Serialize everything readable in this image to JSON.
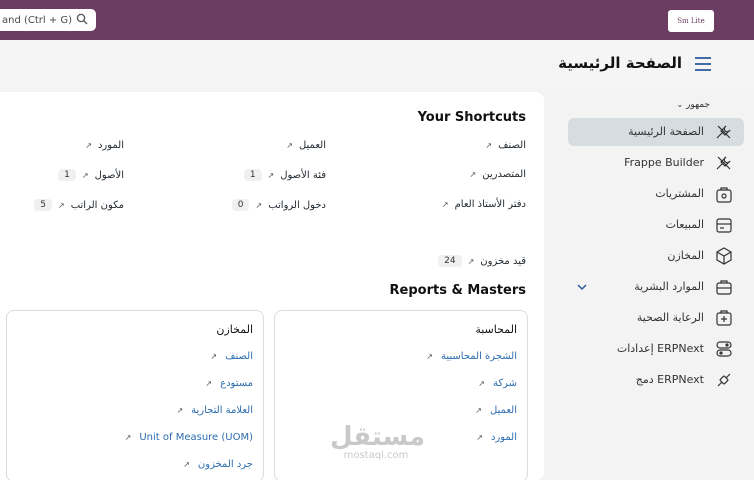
{
  "topbar": {
    "search_text": "and (Ctrl + G)",
    "logo_text": "Sm Lite"
  },
  "page": {
    "title": "الصفحة الرئيسية"
  },
  "sidebar": {
    "group_label": "جمهور",
    "items": [
      {
        "label": "الصفحة الرئيسية",
        "icon": "tools-icon",
        "active": true
      },
      {
        "label": "Frappe Builder",
        "icon": "tools-icon",
        "active": false
      },
      {
        "label": "المشتريات",
        "icon": "basket-icon",
        "active": false
      },
      {
        "label": "المبيعات",
        "icon": "wallet-icon",
        "active": false
      },
      {
        "label": "المخازن",
        "icon": "cube-icon",
        "active": false
      },
      {
        "label": "الموارد البشرية",
        "icon": "briefcase-icon",
        "active": false,
        "expandable": true
      },
      {
        "label": "الرعاية الصحية",
        "icon": "medical-kit-icon",
        "active": false
      },
      {
        "label": "إعدادات ERPNext",
        "icon": "toggle-icon",
        "active": false
      },
      {
        "label": "دمج ERPNext",
        "icon": "plug-icon",
        "active": false
      }
    ]
  },
  "shortcuts": {
    "title": "Your Shortcuts",
    "items": [
      {
        "label": "الصنف",
        "count": ""
      },
      {
        "label": "العميل",
        "count": ""
      },
      {
        "label": "المورد",
        "count": ""
      },
      {
        "label": "المتصدرين",
        "count": ""
      },
      {
        "label": "فئة الأصول",
        "count": "1"
      },
      {
        "label": "الأصول",
        "count": "1"
      },
      {
        "label": "دفتر الأستاذ العام",
        "count": ""
      },
      {
        "label": "دخول الرواتب",
        "count": "0"
      },
      {
        "label": "مكون الراتب",
        "count": "5"
      },
      {
        "label": "قيد مخزون",
        "count": "24"
      }
    ]
  },
  "reports": {
    "title": "Reports & Masters",
    "cards": [
      {
        "title": "المحاسبة",
        "links": [
          "الشجرة المحاسبية",
          "شركة",
          "العميل",
          "المورد"
        ]
      },
      {
        "title": "المخازن",
        "links": [
          "الصنف",
          "مستودع",
          "العلامة التجارية",
          "Unit of Measure (UOM)",
          "جرد المخزون"
        ]
      }
    ]
  },
  "watermark": {
    "arabic": "مستقل",
    "latin": "mostaql.com"
  },
  "colors": {
    "topbar": "#6b3d62",
    "active_item": "#d5dde1",
    "link": "#2b6cb0"
  }
}
